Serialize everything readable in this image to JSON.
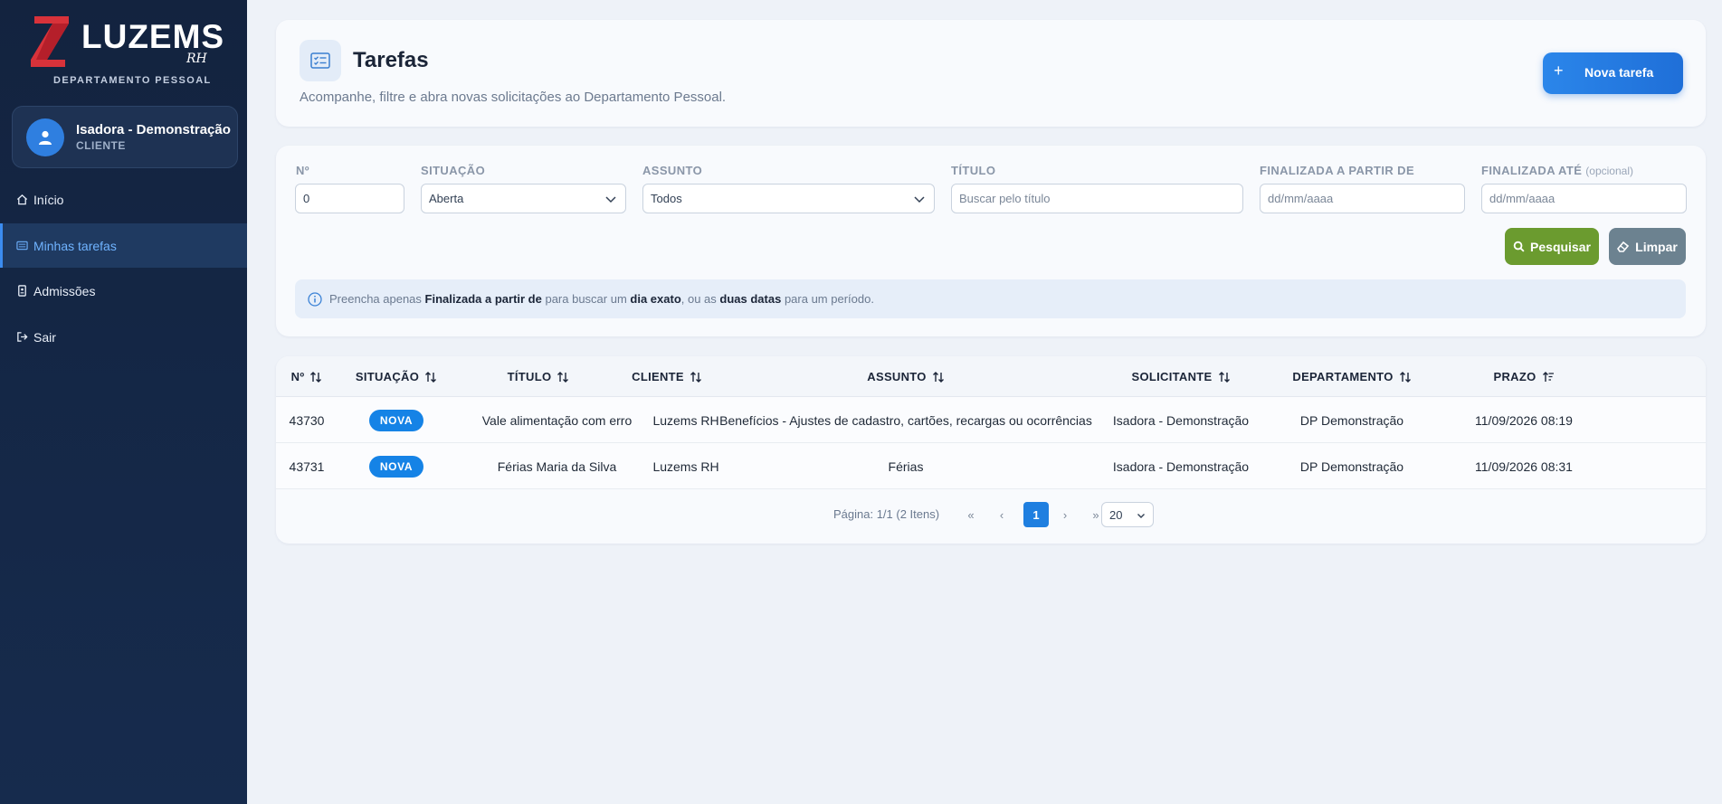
{
  "brand": {
    "name": "LUZEMS",
    "suffix": "RH",
    "department": "DEPARTAMENTO PESSOAL"
  },
  "user": {
    "name": "Isadora - Demonstração",
    "role": "CLIENTE"
  },
  "nav": [
    {
      "label": "Início",
      "icon": "home-icon"
    },
    {
      "label": "Minhas tarefas",
      "icon": "list-icon",
      "active": true
    },
    {
      "label": "Admissões",
      "icon": "badge-icon"
    },
    {
      "label": "Sair",
      "icon": "logout-icon"
    }
  ],
  "header": {
    "title": "Tarefas",
    "subtitle": "Acompanhe, filtre e abra novas solicitações ao Departamento Pessoal.",
    "new_button": "Nova tarefa",
    "new_button_icon": "+"
  },
  "filters": {
    "number_label": "Nº",
    "number_value": "0",
    "status_label": "SITUAÇÃO",
    "status_value": "Aberta",
    "subject_label": "ASSUNTO",
    "subject_value": "Todos",
    "title_label": "TÍTULO",
    "title_placeholder": "Buscar pelo título",
    "from_label": "FINALIZADA A PARTIR DE",
    "from_placeholder": "dd/mm/aaaa",
    "to_label": "FINALIZADA ATÉ",
    "to_optional": "(opcional)",
    "to_placeholder": "dd/mm/aaaa",
    "search_button": "Pesquisar",
    "clear_button": "Limpar",
    "info": {
      "part1": "Preencha apenas ",
      "bold1": "Finalizada a partir de",
      "part2": " para buscar um ",
      "bold2": "dia exato",
      "part3": ", ou as ",
      "bold3": "duas datas",
      "part4": " para um período."
    }
  },
  "table": {
    "columns": [
      "Nº",
      "SITUAÇÃO",
      "TÍTULO",
      "CLIENTE",
      "ASSUNTO",
      "SOLICITANTE",
      "DEPARTAMENTO",
      "PRAZO"
    ],
    "rows": [
      {
        "numero": "43730",
        "situacao": "NOVA",
        "titulo": "Vale alimentação com erro",
        "cliente": "Luzems RH",
        "assunto": "Benefícios - Ajustes de cadastro, cartões, recargas ou ocorrências",
        "solicitante": "Isadora - Demonstração",
        "departamento": "DP Demonstração",
        "prazo": "11/09/2026 08:19"
      },
      {
        "numero": "43731",
        "situacao": "NOVA",
        "titulo": "Férias Maria da Silva",
        "cliente": "Luzems RH",
        "assunto": "Férias",
        "solicitante": "Isadora - Demonstração",
        "departamento": "DP Demonstração",
        "prazo": "11/09/2026 08:31"
      }
    ]
  },
  "pagination": {
    "info": "Página: 1/1 (2 Itens)",
    "first": "«",
    "prev": "‹",
    "current": "1",
    "next": "›",
    "last": "»",
    "page_size": "20"
  },
  "colors": {
    "sidebar": "#13233f",
    "accent": "#1f7fe0",
    "search": "#6b9b2f",
    "clear": "#6c8290",
    "brand_red": "#e0393e"
  }
}
